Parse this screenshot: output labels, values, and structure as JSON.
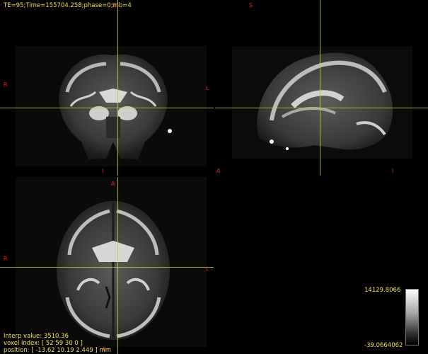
{
  "header": {
    "text": "TE=95;Time=155704.258;phase=0;mb=4"
  },
  "orientation": {
    "coronal": {
      "top": "S",
      "left": "R",
      "right": "L",
      "bottom": "I"
    },
    "sagittal": {
      "top": "S",
      "left": "A",
      "right": "I"
    },
    "axial": {
      "top": "A",
      "left": "R",
      "right": "L",
      "bottom": "P"
    }
  },
  "info": {
    "interp": "Interp value: 3510.36",
    "voxel": "voxel index: [ 52 59 30 0 ]",
    "position": "position: [ -13.62 10.19 2.449 ] mm"
  },
  "colorbar": {
    "max_label": "14129.8066",
    "min_label": "-39.0664062",
    "colormap": "grayscale"
  },
  "colors": {
    "crosshair": "#c8c832",
    "orientation": "#e02020",
    "overlay_text": "#f0e050",
    "background": "#000000"
  }
}
